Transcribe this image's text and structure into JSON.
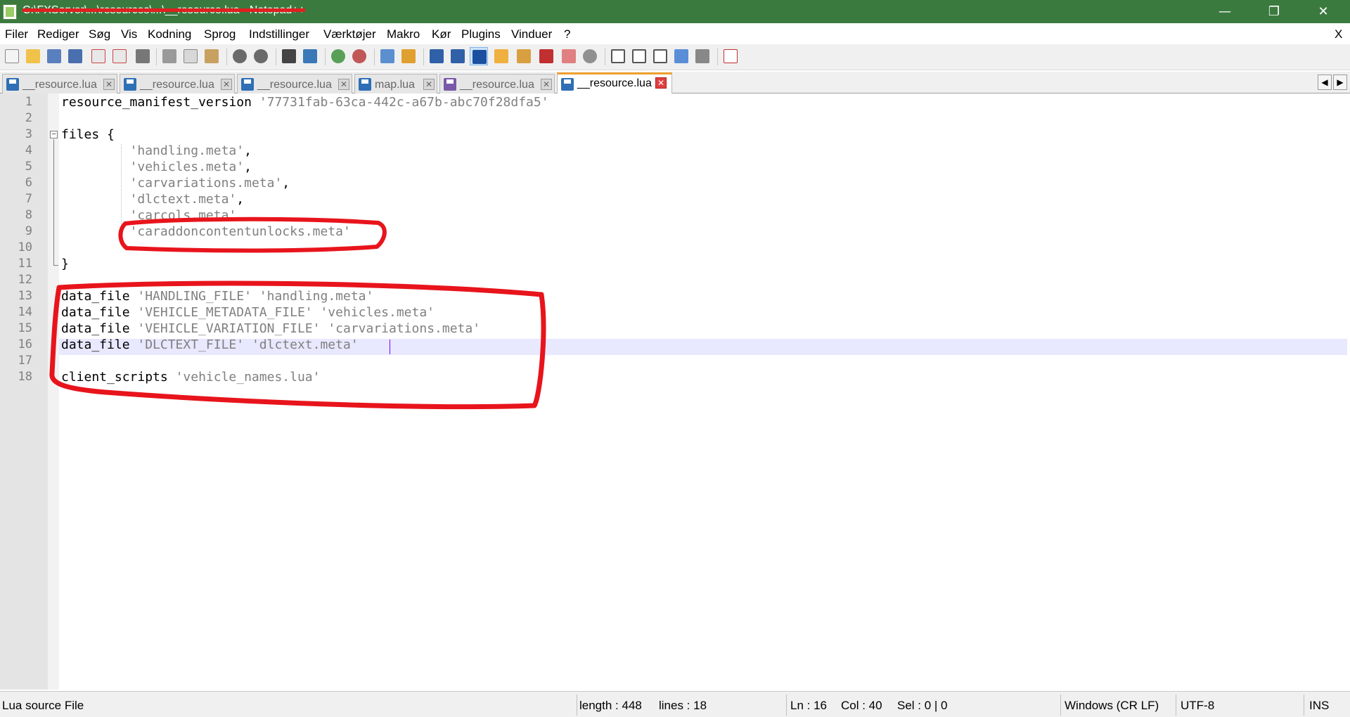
{
  "window": {
    "title": "C:\\FXServer\\...\\resources\\...\\__resource.lua - Notepad++",
    "minimize_glyph": "—",
    "maximize_glyph": "❐",
    "close_glyph": "✕"
  },
  "menu": {
    "items": [
      "Filer",
      "Rediger",
      "Søg",
      "Vis",
      "Kodning",
      "Sprog",
      "Indstillinger",
      "Værktøjer",
      "Makro",
      "Kør",
      "Plugins",
      "Vinduer",
      "?"
    ],
    "close_doc": "X"
  },
  "toolbar": {
    "icons": [
      "new-file-icon",
      "open-file-icon",
      "save-icon",
      "save-all-icon",
      "close-icon",
      "close-all-icon",
      "print-icon",
      "cut-icon",
      "copy-icon",
      "paste-icon",
      "undo-icon",
      "redo-icon",
      "find-icon",
      "replace-icon",
      "zoom-in-icon",
      "zoom-out-icon",
      "sync-vertical-icon",
      "sync-horizontal-icon",
      "word-wrap-icon",
      "show-all-chars-icon",
      "indent-guide-icon",
      "udl-icon",
      "doc-map-icon",
      "function-list-icon",
      "folder-workspace-icon",
      "monitoring-icon",
      "record-macro-icon",
      "stop-macro-icon",
      "play-macro-icon",
      "run-macro-multiple-icon",
      "save-macro-icon",
      "spell-check-icon"
    ]
  },
  "tabs": [
    {
      "label": "__resource.lua",
      "active": false,
      "icon": "saved-file-icon"
    },
    {
      "label": "__resource.lua",
      "active": false,
      "icon": "saved-file-icon"
    },
    {
      "label": "__resource.lua",
      "active": false,
      "icon": "saved-file-icon"
    },
    {
      "label": "map.lua",
      "active": false,
      "icon": "saved-file-icon"
    },
    {
      "label": "__resource.lua",
      "active": false,
      "icon": "modified-file-icon"
    },
    {
      "label": "__resource.lua",
      "active": true,
      "icon": "saved-file-icon"
    }
  ],
  "tab_scroll": {
    "left": "◀",
    "right": "▶"
  },
  "editor": {
    "fold_open": "−",
    "lines": [
      {
        "n": "1",
        "parts": [
          [
            "resource_manifest_version ",
            "k"
          ],
          [
            "'77731fab-63ca-442c-a67b-abc70f28dfa5'",
            "s"
          ]
        ]
      },
      {
        "n": "2",
        "parts": []
      },
      {
        "n": "3",
        "parts": [
          [
            "files {",
            "k"
          ]
        ]
      },
      {
        "n": "4",
        "parts": [
          [
            "         ",
            "k"
          ],
          [
            "'handling.meta'",
            "s"
          ],
          [
            ",",
            "k"
          ]
        ]
      },
      {
        "n": "5",
        "parts": [
          [
            "         ",
            "k"
          ],
          [
            "'vehicles.meta'",
            "s"
          ],
          [
            ",",
            "k"
          ]
        ]
      },
      {
        "n": "6",
        "parts": [
          [
            "         ",
            "k"
          ],
          [
            "'carvariations.meta'",
            "s"
          ],
          [
            ",",
            "k"
          ]
        ]
      },
      {
        "n": "7",
        "parts": [
          [
            "         ",
            "k"
          ],
          [
            "'dlctext.meta'",
            "s"
          ],
          [
            ",",
            "k"
          ]
        ]
      },
      {
        "n": "8",
        "parts": [
          [
            "         ",
            "k"
          ],
          [
            "'carcols.meta'",
            "s"
          ],
          [
            ",",
            "k"
          ]
        ]
      },
      {
        "n": "9",
        "parts": [
          [
            "         ",
            "k"
          ],
          [
            "'caraddoncontentunlocks.meta'",
            "s"
          ]
        ]
      },
      {
        "n": "10",
        "parts": []
      },
      {
        "n": "11",
        "parts": [
          [
            "}",
            "k"
          ]
        ]
      },
      {
        "n": "12",
        "parts": []
      },
      {
        "n": "13",
        "parts": [
          [
            "data_file ",
            "k"
          ],
          [
            "'HANDLING_FILE'",
            "s"
          ],
          [
            " ",
            "k"
          ],
          [
            "'handling.meta'",
            "s"
          ]
        ]
      },
      {
        "n": "14",
        "parts": [
          [
            "data_file ",
            "k"
          ],
          [
            "'VEHICLE_METADATA_FILE'",
            "s"
          ],
          [
            " ",
            "k"
          ],
          [
            "'vehicles.meta'",
            "s"
          ]
        ]
      },
      {
        "n": "15",
        "parts": [
          [
            "data_file ",
            "k"
          ],
          [
            "'VEHICLE_VARIATION_FILE'",
            "s"
          ],
          [
            " ",
            "k"
          ],
          [
            "'carvariations.meta'",
            "s"
          ]
        ]
      },
      {
        "n": "16",
        "parts": [
          [
            "data_file ",
            "k"
          ],
          [
            "'DLCTEXT_FILE'",
            "s"
          ],
          [
            " ",
            "k"
          ],
          [
            "'dlctext.meta'",
            "s"
          ]
        ]
      },
      {
        "n": "17",
        "parts": []
      },
      {
        "n": "18",
        "parts": [
          [
            "client_scripts ",
            "k"
          ],
          [
            "'vehicle_names.lua'",
            "s"
          ]
        ]
      }
    ],
    "current_line": 16
  },
  "annotation": {
    "color": "#e8141c"
  },
  "status": {
    "file_type": "Lua source File",
    "length": "length : 448",
    "lines": "lines : 18",
    "ln": "Ln : 16",
    "col": "Col : 40",
    "sel": "Sel : 0 | 0",
    "eol": "Windows (CR LF)",
    "encoding": "UTF-8",
    "mode": "INS"
  },
  "colors": {
    "titlebar": "#3b7a3f",
    "string": "#808080",
    "current_line": "#e8e8ff"
  }
}
